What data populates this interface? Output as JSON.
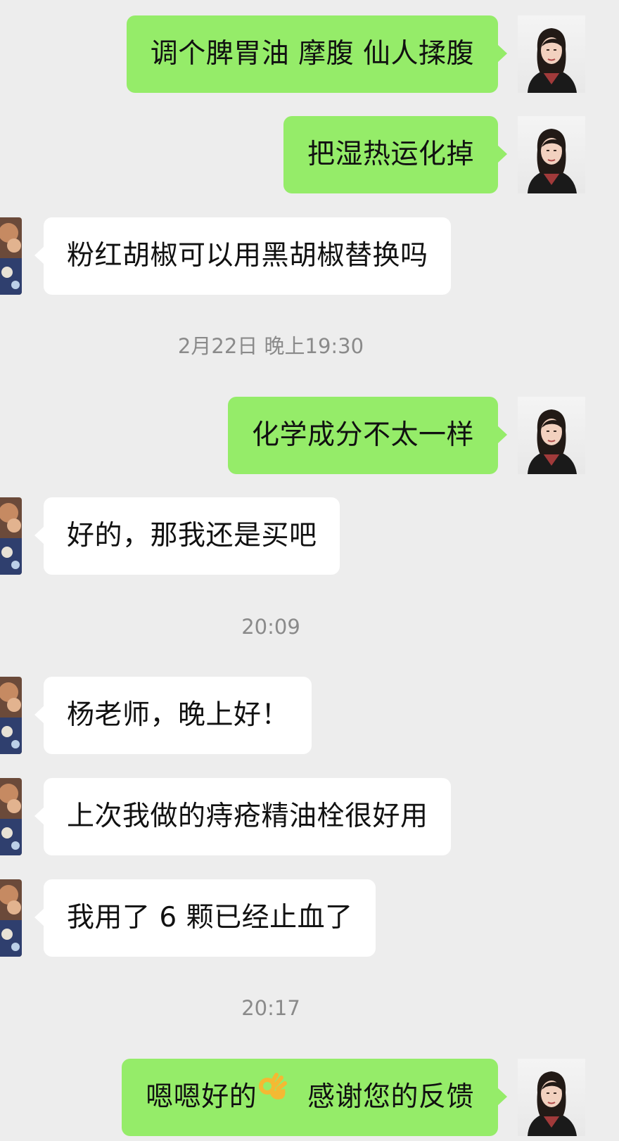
{
  "messages": [
    {
      "side": "out",
      "text": "调个脾胃油  摩腹  仙人揉腹"
    },
    {
      "side": "out",
      "text": "把湿热运化掉"
    },
    {
      "side": "in",
      "text": "粉红胡椒可以用黑胡椒替换吗"
    },
    {
      "type": "time",
      "text": "2月22日 晚上19:30"
    },
    {
      "side": "out",
      "text": "化学成分不太一样"
    },
    {
      "side": "in",
      "text": "好的，那我还是买吧"
    },
    {
      "type": "time",
      "text": "20:09"
    },
    {
      "side": "in",
      "text": "杨老师，晚上好！"
    },
    {
      "side": "in",
      "text": "上次我做的痔疮精油栓很好用"
    },
    {
      "side": "in",
      "text": "我用了 6 颗已经止血了"
    },
    {
      "type": "time",
      "text": "20:17"
    },
    {
      "side": "out",
      "text_before": "嗯嗯好的",
      "emoji": "ok-hand-emoji",
      "text_after": "  感谢您的反馈"
    }
  ],
  "colors": {
    "background": "#ededed",
    "outgoing_bubble": "#95ec69",
    "incoming_bubble": "#ffffff",
    "timestamp_text": "#8a8a8a"
  }
}
